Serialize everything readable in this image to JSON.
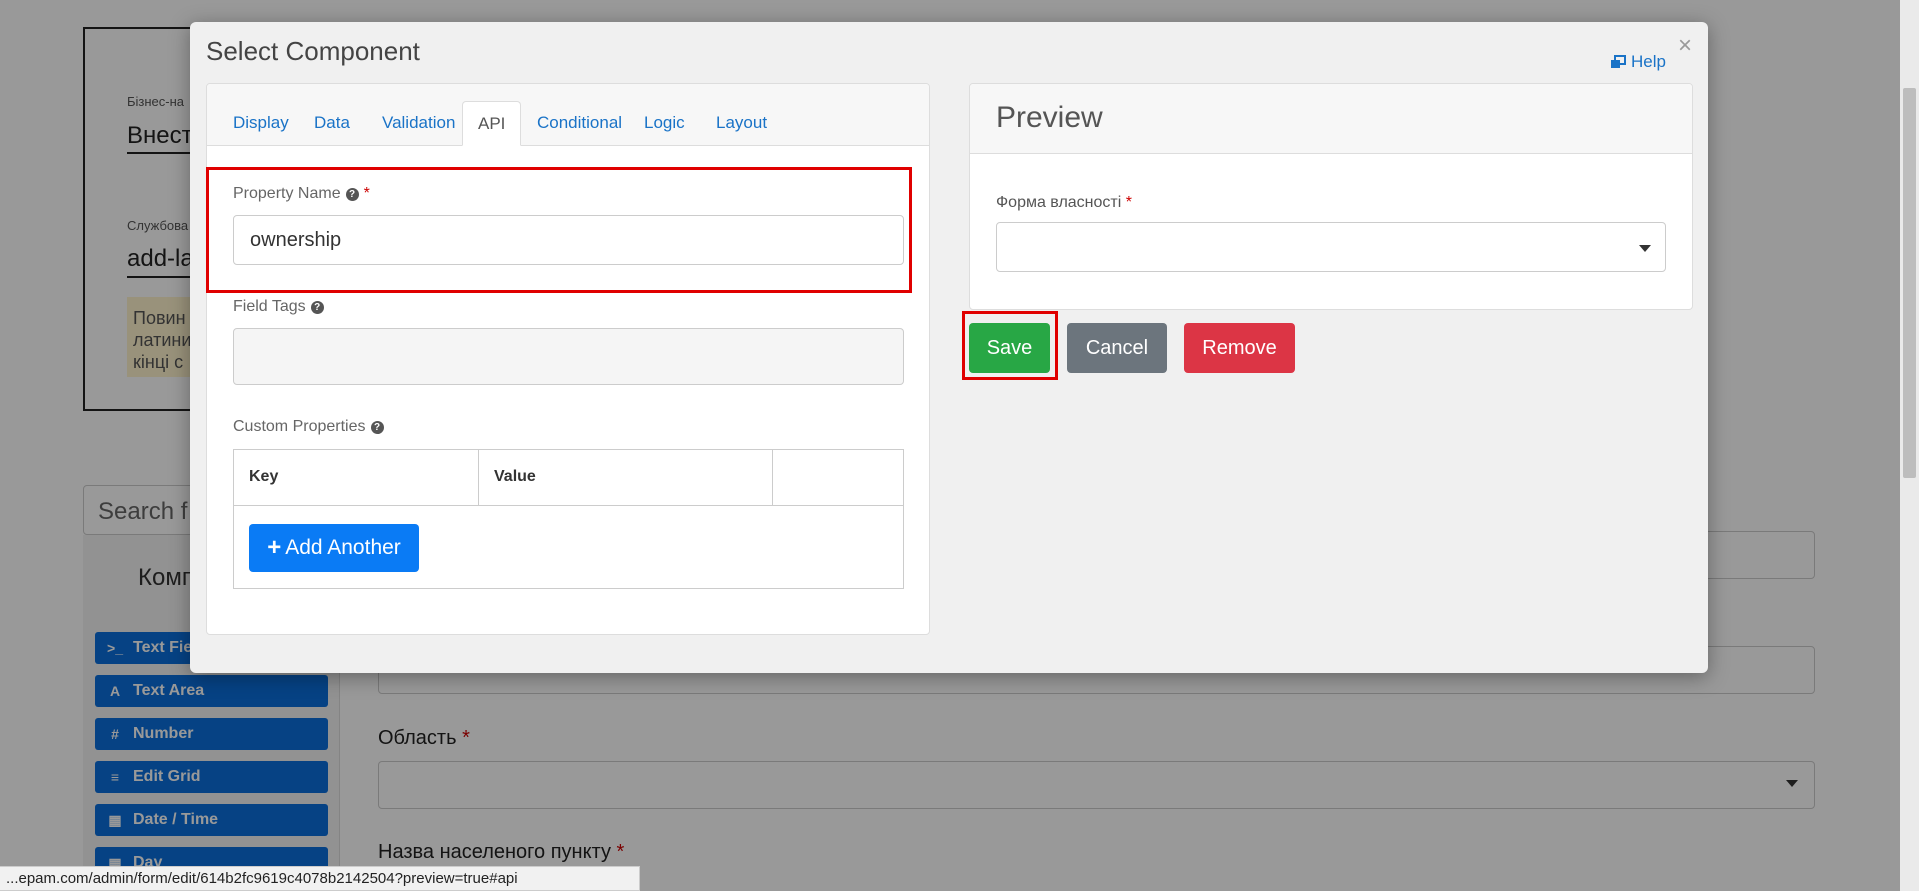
{
  "background": {
    "card_label_1": "Бізнес-на",
    "card_value_1": "Внест",
    "card_label_2": "Службова",
    "card_value_2": "add-la",
    "card_note": "Повин\nлатини\nкінці с",
    "search_text": "Search f",
    "sidebar_heading": "Комп",
    "sidebar_buttons": [
      {
        "icon": ">_",
        "label": "Text Field"
      },
      {
        "icon": "A",
        "label": "Text Area"
      },
      {
        "icon": "#",
        "label": "Number"
      },
      {
        "icon": "≡",
        "label": "Edit Grid"
      },
      {
        "icon": "▦",
        "label": "Date / Time"
      },
      {
        "icon": "▦",
        "label": "Day"
      }
    ],
    "field_label_oblast": "Область",
    "field_label_settlement": "Назва населеного пункту",
    "required_mark": "*"
  },
  "status_url": "...epam.com/admin/form/edit/614b2fc9619c4078b2142504?preview=true#api",
  "modal": {
    "title": "Select Component",
    "close": "×",
    "help_label": "Help",
    "tabs": [
      {
        "label": "Display",
        "active": false
      },
      {
        "label": "Data",
        "active": false
      },
      {
        "label": "Validation",
        "active": false
      },
      {
        "label": "API",
        "active": true
      },
      {
        "label": "Conditional",
        "active": false
      },
      {
        "label": "Logic",
        "active": false
      },
      {
        "label": "Layout",
        "active": false
      }
    ],
    "property_name": {
      "label": "Property Name",
      "required": "*",
      "value": "ownership"
    },
    "field_tags": {
      "label": "Field Tags",
      "value": ""
    },
    "custom_properties": {
      "label": "Custom Properties",
      "columns": [
        "Key",
        "Value",
        ""
      ],
      "add_button": "Add Another"
    },
    "preview": {
      "title": "Preview",
      "field_label": "Форма власності",
      "required": "*",
      "selected_value": ""
    },
    "buttons": {
      "save": "Save",
      "cancel": "Cancel",
      "remove": "Remove"
    }
  },
  "colors": {
    "accent": "#1a73c7",
    "primary_button": "#0a7bf5",
    "save": "#28a745",
    "cancel": "#6c757d",
    "remove": "#dc3545",
    "highlight": "#e00000"
  }
}
